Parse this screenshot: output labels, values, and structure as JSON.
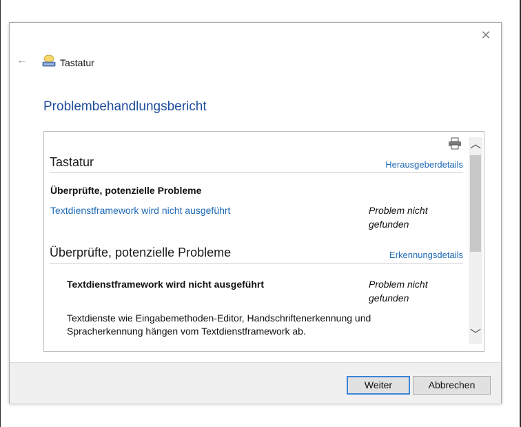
{
  "window": {
    "title": "Tastatur"
  },
  "page": {
    "title": "Problembehandlungsbericht"
  },
  "report": {
    "section1": {
      "title": "Tastatur",
      "link": "Herausgeberdetails",
      "subheading": "Überprüfte, potenzielle Probleme",
      "issue": "Textdienstframework wird nicht ausgeführt",
      "status_line1": "Problem nicht",
      "status_line2": "gefunden"
    },
    "section2": {
      "title": "Überprüfte, potenzielle Probleme",
      "link": "Erkennungsdetails",
      "issue": "Textdienstframework wird nicht ausgeführt",
      "status_line1": "Problem nicht",
      "status_line2": "gefunden",
      "description_line1": "Textdienste wie Eingabemethoden-Editor, Handschriftenerkennung und",
      "description_line2": "Spracherkennung hängen vom Textdienstframework ab."
    }
  },
  "buttons": {
    "next": "Weiter",
    "cancel": "Abbrechen"
  },
  "icons": {
    "close": "close-icon",
    "back": "back-arrow-icon",
    "app": "keyboard-troubleshooter-icon",
    "print": "printer-icon",
    "scroll_up": "chevron-up-icon",
    "scroll_down": "chevron-down-icon"
  },
  "colors": {
    "title": "#1f4e9c",
    "link": "#1e6ab7",
    "primary_border": "#3b83d6"
  }
}
